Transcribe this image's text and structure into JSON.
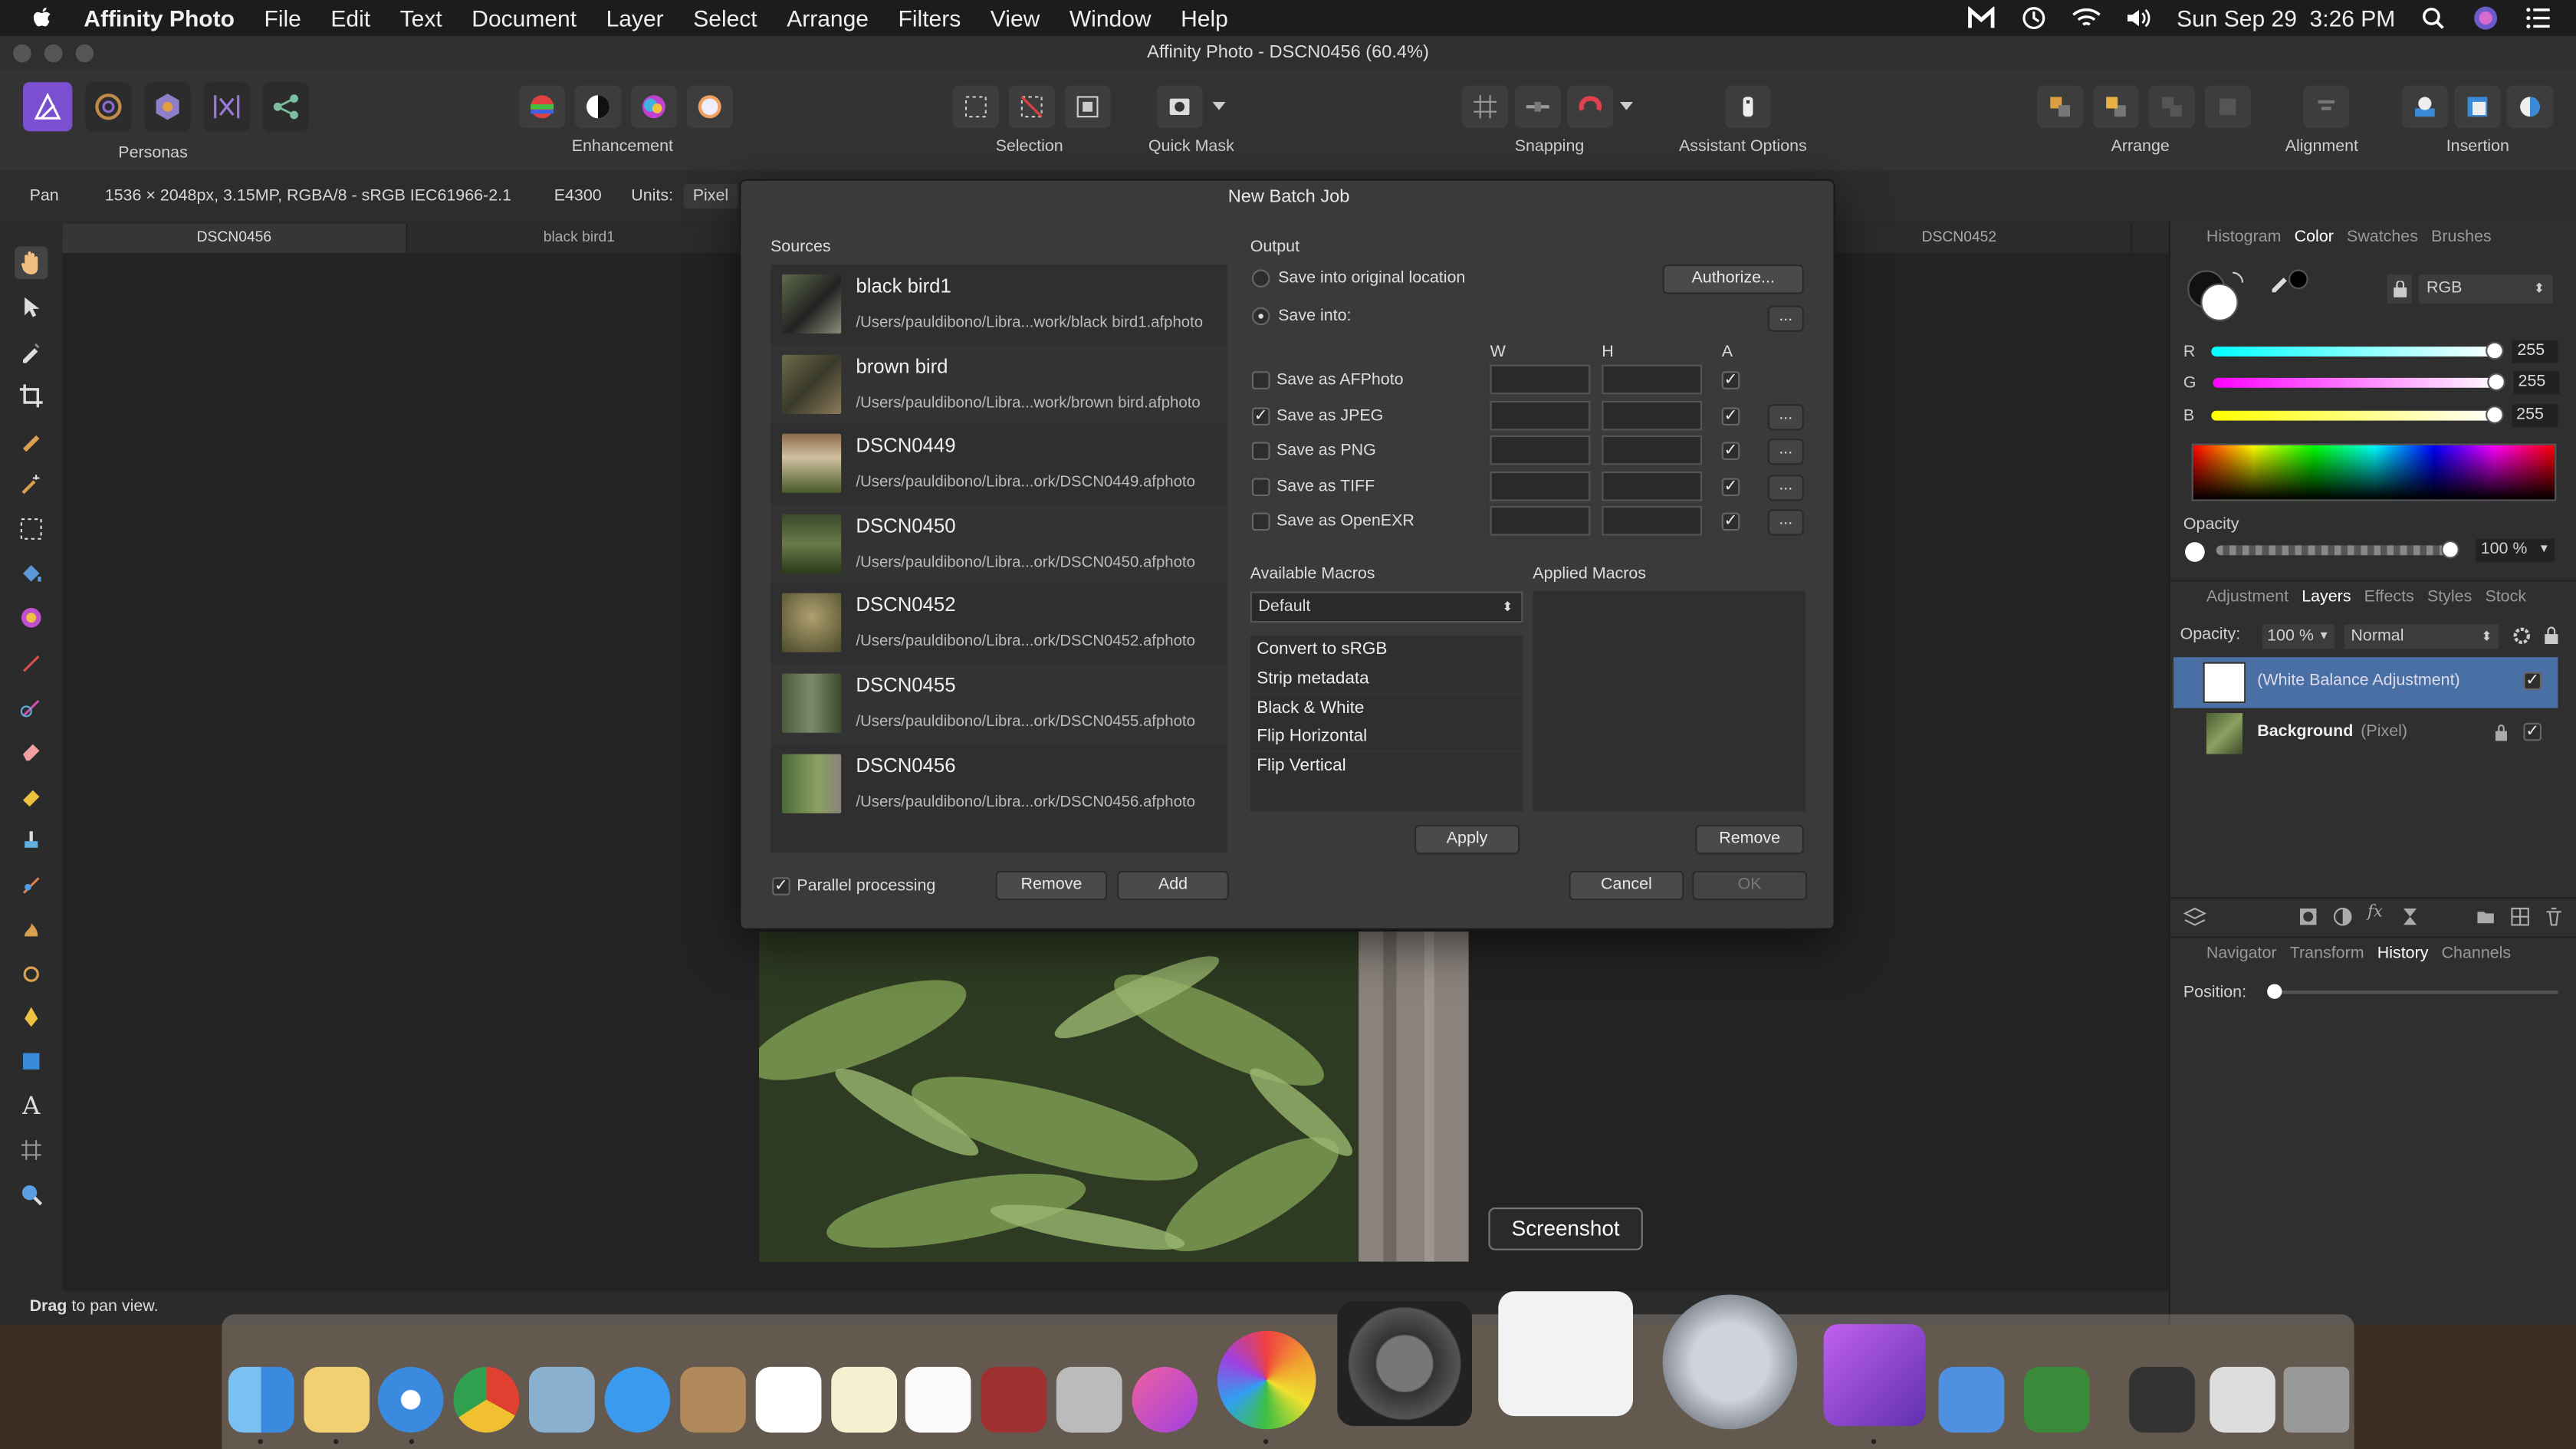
{
  "menubar": {
    "app_name": "Affinity Photo",
    "items": [
      "File",
      "Edit",
      "Text",
      "Document",
      "Layer",
      "Select",
      "Arrange",
      "Filters",
      "View",
      "Window",
      "Help"
    ],
    "clock": "Sun Sep 29  3:26 PM"
  },
  "window": {
    "title": "Affinity Photo - DSCN0456 (60.4%)"
  },
  "toolbar": {
    "personas_label": "Personas",
    "enhancement_label": "Enhancement",
    "selection_label": "Selection",
    "quickmask_label": "Quick Mask",
    "snapping_label": "Snapping",
    "assistant_label": "Assistant Options",
    "arrange_label": "Arrange",
    "alignment_label": "Alignment",
    "insertion_label": "Insertion"
  },
  "context": {
    "tool": "Pan",
    "info": "1536 × 2048px, 3.15MP, RGBA/8 - sRGB IEC61966-2.1",
    "camera": "E4300",
    "units_label": "Units:",
    "units_value": "Pixel"
  },
  "doc_tabs": [
    "DSCN0456",
    "black bird1",
    "",
    "",
    "",
    "DSCN0452"
  ],
  "status": {
    "bold": "Drag",
    "rest": " to pan view."
  },
  "dialog": {
    "title": "New Batch Job",
    "sources_label": "Sources",
    "sources": [
      {
        "name": "black bird1",
        "path": "/Users/pauldibono/Libra...work/black bird1.afphoto"
      },
      {
        "name": "brown bird",
        "path": "/Users/pauldibono/Libra...work/brown bird.afphoto"
      },
      {
        "name": "DSCN0449",
        "path": "/Users/pauldibono/Libra...ork/DSCN0449.afphoto"
      },
      {
        "name": "DSCN0450",
        "path": "/Users/pauldibono/Libra...ork/DSCN0450.afphoto"
      },
      {
        "name": "DSCN0452",
        "path": "/Users/pauldibono/Libra...ork/DSCN0452.afphoto"
      },
      {
        "name": "DSCN0455",
        "path": "/Users/pauldibono/Libra...ork/DSCN0455.afphoto"
      },
      {
        "name": "DSCN0456",
        "path": "/Users/pauldibono/Libra...ork/DSCN0456.afphoto"
      }
    ],
    "parallel_label": "Parallel processing",
    "remove_label": "Remove",
    "add_label": "Add",
    "output_label": "Output",
    "save_original_label": "Save into original location",
    "authorize_label": "Authorize...",
    "save_into_label": "Save into:",
    "col_w": "W",
    "col_h": "H",
    "col_a": "A",
    "formats": [
      "Save as AFPhoto",
      "Save as JPEG",
      "Save as PNG",
      "Save as TIFF",
      "Save as OpenEXR"
    ],
    "available_macros_label": "Available Macros",
    "applied_macros_label": "Applied Macros",
    "macro_set": "Default",
    "macros": [
      "Convert to sRGB",
      "Strip metadata",
      "Black & White",
      "Flip Horizontal",
      "Flip Vertical"
    ],
    "apply_label": "Apply",
    "remove_macro_label": "Remove",
    "cancel_label": "Cancel",
    "ok_label": "OK",
    "dots": "..."
  },
  "right_panel": {
    "tabs1": [
      "Histogram",
      "Color",
      "Swatches",
      "Brushes"
    ],
    "color_model": "RGB",
    "r_label": "R",
    "g_label": "G",
    "b_label": "B",
    "r": "255",
    "g": "255",
    "b": "255",
    "opacity_label": "Opacity",
    "opacity_value": "100 %",
    "tabs2": [
      "Adjustment",
      "Layers",
      "Effects",
      "Styles",
      "Stock"
    ],
    "layers_opacity_label": "Opacity:",
    "layers_opacity_value": "100 %",
    "blend_mode": "Normal",
    "layers": [
      {
        "name": "(White Balance Adjustment)",
        "type": ""
      },
      {
        "name": "Background",
        "type": "(Pixel)"
      }
    ],
    "tabs3": [
      "Navigator",
      "Transform",
      "History",
      "Channels"
    ],
    "position_label": "Position:"
  },
  "tooltip": "Screenshot"
}
